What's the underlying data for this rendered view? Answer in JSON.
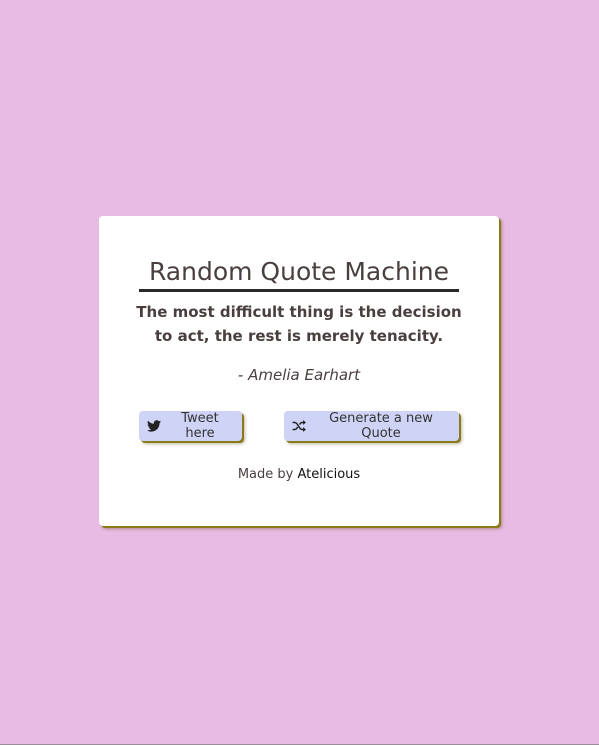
{
  "title": "Random Quote Machine",
  "quote": {
    "text": "The most difficult thing is the decision to act, the rest is merely tenacity.",
    "author": "- Amelia Earhart"
  },
  "buttons": {
    "tweet_label": "Tweet here",
    "tweet_icon": "twitter-icon",
    "new_quote_label": "Generate a new Quote",
    "new_quote_icon": "shuffle-icon"
  },
  "credit": {
    "prefix": "Made by",
    "author_link": "Atelicious"
  },
  "colors": {
    "background": "#e8bbe4",
    "card": "#ffffff",
    "button": "#cfd4f7",
    "shadow": "#8b7a1a",
    "text": "#4a3f3f"
  }
}
